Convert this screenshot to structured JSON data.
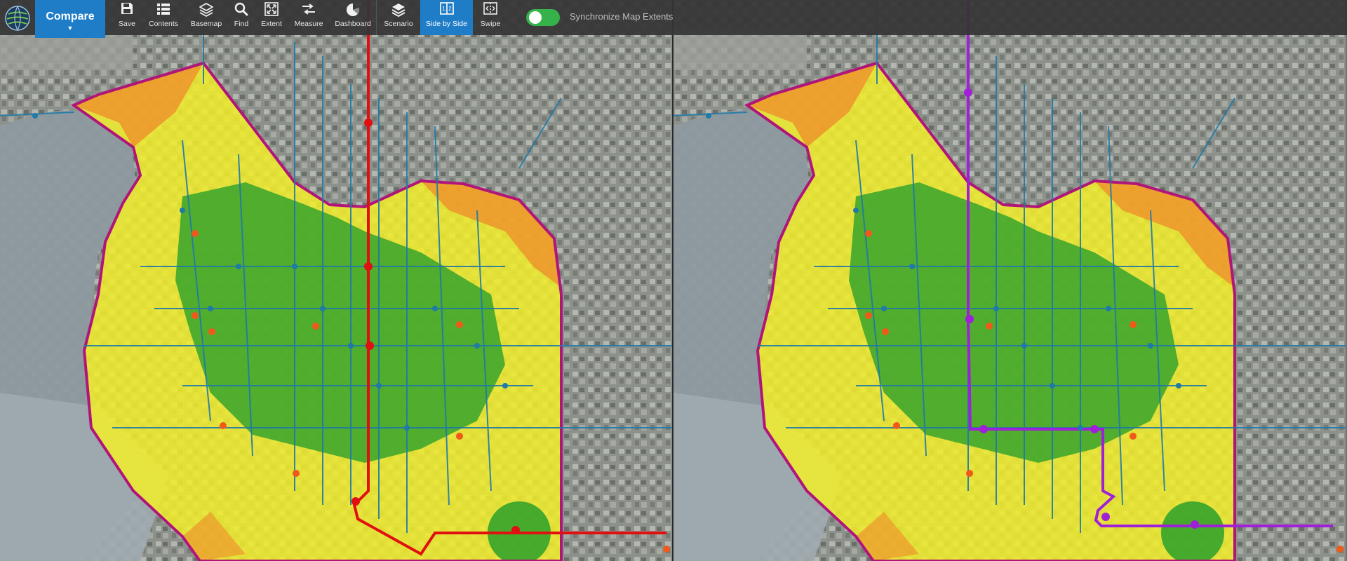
{
  "app": {
    "compare_label": "Compare"
  },
  "toolbar": {
    "tools": [
      {
        "label": "Save",
        "icon": "floppy-disk-icon"
      },
      {
        "label": "Contents",
        "icon": "list-icon"
      },
      {
        "label": "Basemap",
        "icon": "layers-icon"
      },
      {
        "label": "Find",
        "icon": "magnifier-icon"
      },
      {
        "label": "Extent",
        "icon": "extent-icon"
      },
      {
        "label": "Measure",
        "icon": "ruler-icon"
      },
      {
        "label": "Dashboard",
        "icon": "pie-chart-icon"
      },
      {
        "label": "Scenario",
        "icon": "stack-icon"
      },
      {
        "label": "Side by Side",
        "icon": "side-by-side-icon"
      },
      {
        "label": "Swipe",
        "icon": "swipe-icon"
      }
    ],
    "active_tool": "Side by Side",
    "sync_label": "Synchronize Map Extents",
    "sync_enabled": true
  },
  "maps": {
    "left": {
      "route_color": "#e01010"
    },
    "right": {
      "route_color": "#a020d8"
    }
  },
  "colors": {
    "accent": "#1f7dc8",
    "toggle_on": "#36b24a",
    "boundary": "#b0157a",
    "zone_yellow": "#f2ee2a",
    "zone_orange": "#ef8a2a",
    "zone_green": "#2aa02a",
    "transit_lines": "#1f7aa8",
    "stops_orange": "#ef5a1a"
  }
}
